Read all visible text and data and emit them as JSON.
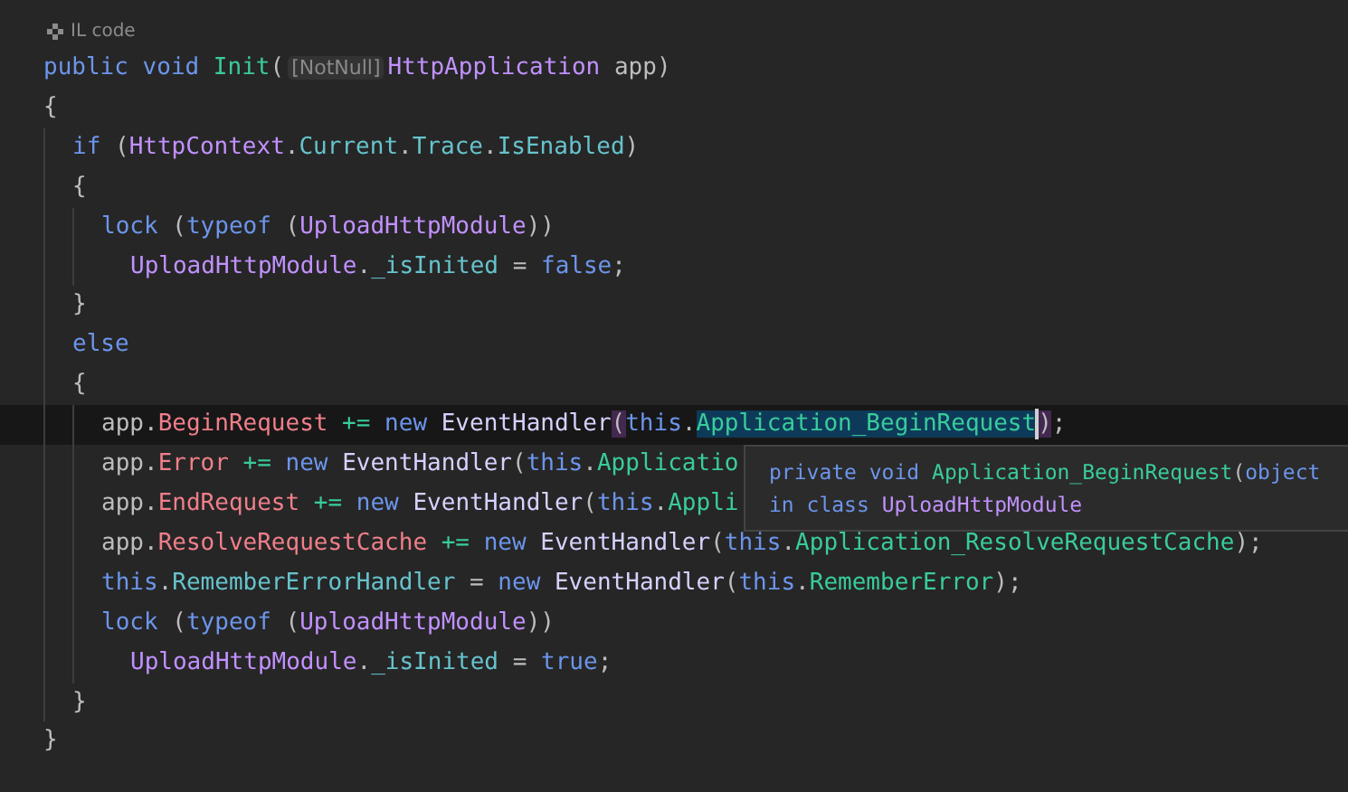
{
  "header": {
    "label": "IL code"
  },
  "code": [
    {
      "tokens": [
        {
          "text": "public void ",
          "kind": "kw"
        },
        {
          "text": "Init",
          "kind": "method"
        },
        {
          "text": "(",
          "kind": "text"
        },
        {
          "text": "[NotNull]",
          "kind": "hint"
        },
        {
          "text": "HttpApplication",
          "kind": "type"
        },
        {
          "text": " app)",
          "kind": "text"
        }
      ]
    },
    {
      "tokens": [
        {
          "text": "{",
          "kind": "text"
        }
      ],
      "guide": true,
      "children": [
        {
          "tokens": [
            {
              "text": "if",
              "kind": "kw"
            },
            {
              "text": " (",
              "kind": "text"
            },
            {
              "text": "HttpContext",
              "kind": "type"
            },
            {
              "text": ".",
              "kind": "text"
            },
            {
              "text": "Current",
              "kind": "prop"
            },
            {
              "text": ".",
              "kind": "text"
            },
            {
              "text": "Trace",
              "kind": "prop"
            },
            {
              "text": ".",
              "kind": "text"
            },
            {
              "text": "IsEnabled",
              "kind": "prop"
            },
            {
              "text": ")",
              "kind": "text"
            }
          ]
        },
        {
          "tokens": [
            {
              "text": "{",
              "kind": "text"
            }
          ],
          "guide": true,
          "children": [
            {
              "tokens": [
                {
                  "text": "lock",
                  "kind": "kw"
                },
                {
                  "text": " (",
                  "kind": "text"
                },
                {
                  "text": "typeof",
                  "kind": "kw"
                },
                {
                  "text": " (",
                  "kind": "text"
                },
                {
                  "text": "UploadHttpModule",
                  "kind": "type"
                },
                {
                  "text": "))",
                  "kind": "text"
                }
              ],
              "children": [
                {
                  "tokens": [
                    {
                      "text": "UploadHttpModule",
                      "kind": "type"
                    },
                    {
                      "text": ".",
                      "kind": "text"
                    },
                    {
                      "text": "_isInited",
                      "kind": "prop"
                    },
                    {
                      "text": " = ",
                      "kind": "text"
                    },
                    {
                      "text": "false",
                      "kind": "kw"
                    },
                    {
                      "text": ";",
                      "kind": "text"
                    }
                  ]
                }
              ]
            }
          ]
        },
        {
          "tokens": [
            {
              "text": "}",
              "kind": "text"
            }
          ]
        },
        {
          "tokens": [
            {
              "text": "else",
              "kind": "kw"
            }
          ]
        },
        {
          "tokens": [
            {
              "text": "{",
              "kind": "text"
            }
          ],
          "guide": true,
          "children": [
            {
              "current": true,
              "tokens": [
                {
                  "text": "app.",
                  "kind": "text"
                },
                {
                  "text": "BeginRequest",
                  "kind": "event"
                },
                {
                  "text": " += ",
                  "kind": "op"
                },
                {
                  "text": "new ",
                  "kind": "kw"
                },
                {
                  "text": "EventHandler",
                  "kind": "delegate"
                },
                {
                  "text": "(",
                  "kind": "text",
                  "matched": true
                },
                {
                  "text": "this",
                  "kind": "kw"
                },
                {
                  "text": ".",
                  "kind": "text"
                },
                {
                  "text": "Application_BeginRequest",
                  "kind": "method",
                  "selected": true
                },
                {
                  "text": ")",
                  "kind": "text",
                  "matched": true
                },
                {
                  "text": ";",
                  "kind": "text"
                }
              ]
            },
            {
              "tokens": [
                {
                  "text": "app.",
                  "kind": "text"
                },
                {
                  "text": "Error",
                  "kind": "event"
                },
                {
                  "text": " += ",
                  "kind": "op"
                },
                {
                  "text": "new ",
                  "kind": "kw"
                },
                {
                  "text": "EventHandler",
                  "kind": "delegate"
                },
                {
                  "text": "(",
                  "kind": "text"
                },
                {
                  "text": "this",
                  "kind": "kw"
                },
                {
                  "text": ".",
                  "kind": "text"
                },
                {
                  "text": "Applicatio",
                  "kind": "method"
                }
              ]
            },
            {
              "tokens": [
                {
                  "text": "app.",
                  "kind": "text"
                },
                {
                  "text": "EndRequest",
                  "kind": "event"
                },
                {
                  "text": " += ",
                  "kind": "op"
                },
                {
                  "text": "new ",
                  "kind": "kw"
                },
                {
                  "text": "EventHandler",
                  "kind": "delegate"
                },
                {
                  "text": "(",
                  "kind": "text"
                },
                {
                  "text": "this",
                  "kind": "kw"
                },
                {
                  "text": ".",
                  "kind": "text"
                },
                {
                  "text": "Appli",
                  "kind": "method"
                }
              ]
            },
            {
              "tokens": [
                {
                  "text": "app.",
                  "kind": "text"
                },
                {
                  "text": "ResolveRequestCache",
                  "kind": "event"
                },
                {
                  "text": " += ",
                  "kind": "op"
                },
                {
                  "text": "new ",
                  "kind": "kw"
                },
                {
                  "text": "EventHandler",
                  "kind": "delegate"
                },
                {
                  "text": "(",
                  "kind": "text"
                },
                {
                  "text": "this",
                  "kind": "kw"
                },
                {
                  "text": ".",
                  "kind": "text"
                },
                {
                  "text": "Application_ResolveRequestCache",
                  "kind": "method"
                },
                {
                  "text": ");",
                  "kind": "text"
                }
              ]
            },
            {
              "tokens": [
                {
                  "text": "this",
                  "kind": "kw"
                },
                {
                  "text": ".",
                  "kind": "text"
                },
                {
                  "text": "RememberErrorHandler",
                  "kind": "prop"
                },
                {
                  "text": " = ",
                  "kind": "text"
                },
                {
                  "text": "new ",
                  "kind": "kw"
                },
                {
                  "text": "EventHandler",
                  "kind": "delegate"
                },
                {
                  "text": "(",
                  "kind": "text"
                },
                {
                  "text": "this",
                  "kind": "kw"
                },
                {
                  "text": ".",
                  "kind": "text"
                },
                {
                  "text": "RememberError",
                  "kind": "method"
                },
                {
                  "text": ");",
                  "kind": "text"
                }
              ]
            },
            {
              "tokens": [
                {
                  "text": "lock",
                  "kind": "kw"
                },
                {
                  "text": " (",
                  "kind": "text"
                },
                {
                  "text": "typeof",
                  "kind": "kw"
                },
                {
                  "text": " (",
                  "kind": "text"
                },
                {
                  "text": "UploadHttpModule",
                  "kind": "type"
                },
                {
                  "text": "))",
                  "kind": "text"
                }
              ],
              "children": [
                {
                  "tokens": [
                    {
                      "text": "UploadHttpModule",
                      "kind": "type"
                    },
                    {
                      "text": ".",
                      "kind": "text"
                    },
                    {
                      "text": "_isInited",
                      "kind": "prop"
                    },
                    {
                      "text": " = ",
                      "kind": "text"
                    },
                    {
                      "text": "true",
                      "kind": "kw"
                    },
                    {
                      "text": ";",
                      "kind": "text"
                    }
                  ]
                }
              ]
            }
          ]
        },
        {
          "tokens": [
            {
              "text": "}",
              "kind": "text"
            }
          ]
        }
      ]
    },
    {
      "tokens": [
        {
          "text": "}",
          "kind": "text"
        }
      ]
    }
  ],
  "tooltip": {
    "lines": [
      {
        "tokens": [
          {
            "text": "private void ",
            "kind": "kw"
          },
          {
            "text": "Application_BeginRequest",
            "kind": "method"
          },
          {
            "text": "(",
            "kind": "text"
          },
          {
            "text": "object",
            "kind": "kw"
          }
        ]
      },
      {
        "tokens": [
          {
            "text": "in class ",
            "kind": "kw"
          },
          {
            "text": "UploadHttpModule",
            "kind": "type"
          }
        ]
      }
    ]
  }
}
